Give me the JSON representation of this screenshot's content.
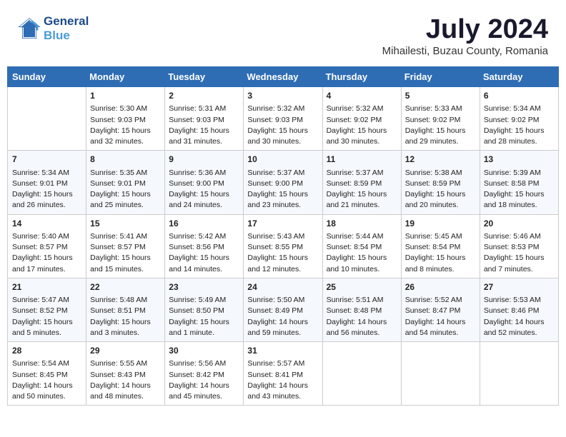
{
  "header": {
    "logo_line1": "General",
    "logo_line2": "Blue",
    "month_year": "July 2024",
    "location": "Mihailesti, Buzau County, Romania"
  },
  "days_of_week": [
    "Sunday",
    "Monday",
    "Tuesday",
    "Wednesday",
    "Thursday",
    "Friday",
    "Saturday"
  ],
  "weeks": [
    [
      {
        "day": "",
        "empty": true
      },
      {
        "day": "1",
        "sunrise": "5:30 AM",
        "sunset": "9:03 PM",
        "daylight": "15 hours and 32 minutes."
      },
      {
        "day": "2",
        "sunrise": "5:31 AM",
        "sunset": "9:03 PM",
        "daylight": "15 hours and 31 minutes."
      },
      {
        "day": "3",
        "sunrise": "5:32 AM",
        "sunset": "9:03 PM",
        "daylight": "15 hours and 30 minutes."
      },
      {
        "day": "4",
        "sunrise": "5:32 AM",
        "sunset": "9:02 PM",
        "daylight": "15 hours and 30 minutes."
      },
      {
        "day": "5",
        "sunrise": "5:33 AM",
        "sunset": "9:02 PM",
        "daylight": "15 hours and 29 minutes."
      },
      {
        "day": "6",
        "sunrise": "5:34 AM",
        "sunset": "9:02 PM",
        "daylight": "15 hours and 28 minutes."
      }
    ],
    [
      {
        "day": "7",
        "sunrise": "5:34 AM",
        "sunset": "9:01 PM",
        "daylight": "15 hours and 26 minutes."
      },
      {
        "day": "8",
        "sunrise": "5:35 AM",
        "sunset": "9:01 PM",
        "daylight": "15 hours and 25 minutes."
      },
      {
        "day": "9",
        "sunrise": "5:36 AM",
        "sunset": "9:00 PM",
        "daylight": "15 hours and 24 minutes."
      },
      {
        "day": "10",
        "sunrise": "5:37 AM",
        "sunset": "9:00 PM",
        "daylight": "15 hours and 23 minutes."
      },
      {
        "day": "11",
        "sunrise": "5:37 AM",
        "sunset": "8:59 PM",
        "daylight": "15 hours and 21 minutes."
      },
      {
        "day": "12",
        "sunrise": "5:38 AM",
        "sunset": "8:59 PM",
        "daylight": "15 hours and 20 minutes."
      },
      {
        "day": "13",
        "sunrise": "5:39 AM",
        "sunset": "8:58 PM",
        "daylight": "15 hours and 18 minutes."
      }
    ],
    [
      {
        "day": "14",
        "sunrise": "5:40 AM",
        "sunset": "8:57 PM",
        "daylight": "15 hours and 17 minutes."
      },
      {
        "day": "15",
        "sunrise": "5:41 AM",
        "sunset": "8:57 PM",
        "daylight": "15 hours and 15 minutes."
      },
      {
        "day": "16",
        "sunrise": "5:42 AM",
        "sunset": "8:56 PM",
        "daylight": "15 hours and 14 minutes."
      },
      {
        "day": "17",
        "sunrise": "5:43 AM",
        "sunset": "8:55 PM",
        "daylight": "15 hours and 12 minutes."
      },
      {
        "day": "18",
        "sunrise": "5:44 AM",
        "sunset": "8:54 PM",
        "daylight": "15 hours and 10 minutes."
      },
      {
        "day": "19",
        "sunrise": "5:45 AM",
        "sunset": "8:54 PM",
        "daylight": "15 hours and 8 minutes."
      },
      {
        "day": "20",
        "sunrise": "5:46 AM",
        "sunset": "8:53 PM",
        "daylight": "15 hours and 7 minutes."
      }
    ],
    [
      {
        "day": "21",
        "sunrise": "5:47 AM",
        "sunset": "8:52 PM",
        "daylight": "15 hours and 5 minutes."
      },
      {
        "day": "22",
        "sunrise": "5:48 AM",
        "sunset": "8:51 PM",
        "daylight": "15 hours and 3 minutes."
      },
      {
        "day": "23",
        "sunrise": "5:49 AM",
        "sunset": "8:50 PM",
        "daylight": "15 hours and 1 minute."
      },
      {
        "day": "24",
        "sunrise": "5:50 AM",
        "sunset": "8:49 PM",
        "daylight": "14 hours and 59 minutes."
      },
      {
        "day": "25",
        "sunrise": "5:51 AM",
        "sunset": "8:48 PM",
        "daylight": "14 hours and 56 minutes."
      },
      {
        "day": "26",
        "sunrise": "5:52 AM",
        "sunset": "8:47 PM",
        "daylight": "14 hours and 54 minutes."
      },
      {
        "day": "27",
        "sunrise": "5:53 AM",
        "sunset": "8:46 PM",
        "daylight": "14 hours and 52 minutes."
      }
    ],
    [
      {
        "day": "28",
        "sunrise": "5:54 AM",
        "sunset": "8:45 PM",
        "daylight": "14 hours and 50 minutes."
      },
      {
        "day": "29",
        "sunrise": "5:55 AM",
        "sunset": "8:43 PM",
        "daylight": "14 hours and 48 minutes."
      },
      {
        "day": "30",
        "sunrise": "5:56 AM",
        "sunset": "8:42 PM",
        "daylight": "14 hours and 45 minutes."
      },
      {
        "day": "31",
        "sunrise": "5:57 AM",
        "sunset": "8:41 PM",
        "daylight": "14 hours and 43 minutes."
      },
      {
        "day": "",
        "empty": true
      },
      {
        "day": "",
        "empty": true
      },
      {
        "day": "",
        "empty": true
      }
    ]
  ],
  "labels": {
    "sunrise_prefix": "Sunrise: ",
    "sunset_prefix": "Sunset: ",
    "daylight_prefix": "Daylight: "
  }
}
